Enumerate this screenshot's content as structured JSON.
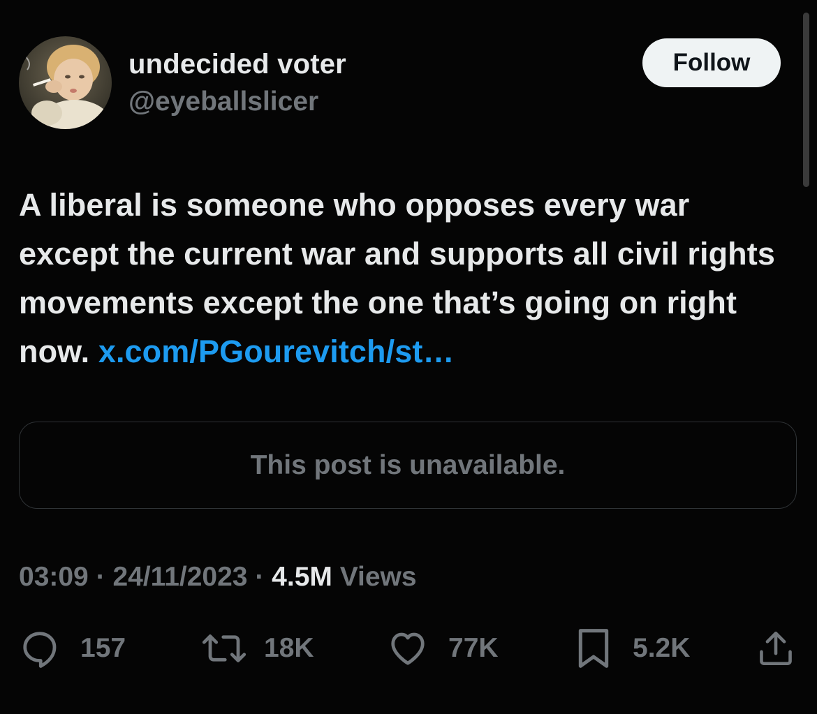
{
  "user": {
    "display_name": "undecided voter",
    "handle": "@eyeballslicer",
    "avatar_icon": "avatar-photo"
  },
  "follow": {
    "label": "Follow"
  },
  "tweet": {
    "text": "A liberal is someone who opposes every war except the current war and supports all civil rights movements except the one that’s going on right now.",
    "link": "x.com/PGourevitch/st…"
  },
  "quote": {
    "text": "This post is unavailable."
  },
  "meta": {
    "time": "03:09",
    "separator": "·",
    "date": "24/11/2023",
    "views_count": "4.5M",
    "views_label": "Views"
  },
  "actions": {
    "replies": "157",
    "reposts": "18K",
    "likes": "77K",
    "bookmarks": "5.2K",
    "icons": [
      "reply-icon",
      "repost-icon",
      "like-icon",
      "bookmark-icon",
      "share-icon"
    ]
  },
  "colors": {
    "background": "#050505",
    "text": "#e7e9ea",
    "secondary": "#71767b",
    "link": "#1d9bf0",
    "button_bg": "#eff3f4",
    "border": "#2f3336"
  }
}
